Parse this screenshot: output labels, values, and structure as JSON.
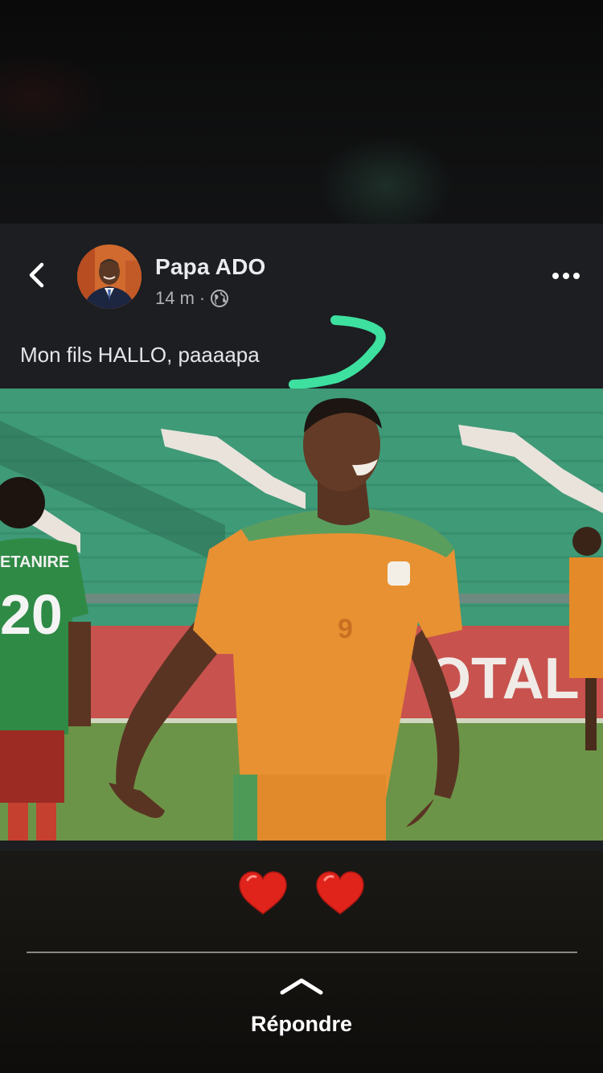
{
  "post": {
    "author": "Papa ADO",
    "time": "14 m",
    "separator": "·",
    "caption": "Mon fils HALLO, paaaapa",
    "image": {
      "player_number": "9",
      "opponent_number": "20",
      "opponent_name_partial": "ETANIRE",
      "banner_text": "OTAL"
    }
  },
  "reactions": {
    "emojis": [
      "❤️",
      "❤️"
    ]
  },
  "reply": {
    "label": "Répondre"
  },
  "colors": {
    "card_bg": "#1c1e21",
    "annotation_green": "#3ee0a0",
    "text_primary": "#e4e6eb",
    "text_secondary": "#b0b3b8"
  },
  "icons": {
    "back": "chevron-left-icon",
    "more": "more-horizontal-icon",
    "privacy": "globe-icon",
    "reply": "chevron-up-icon"
  }
}
